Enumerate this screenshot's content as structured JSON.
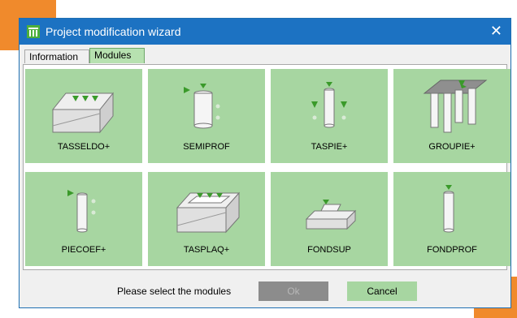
{
  "window": {
    "title": "Project modification wizard",
    "close_glyph": "✕",
    "app_icon": "table-icon"
  },
  "tabs": [
    {
      "label": "Information",
      "active": false
    },
    {
      "label": "Modules",
      "active": true
    }
  ],
  "modules": [
    {
      "label": "TASSELDO+",
      "icon": "slab-foundation-icon"
    },
    {
      "label": "SEMIPROF",
      "icon": "semi-deep-foundation-icon"
    },
    {
      "label": "TASPIE+",
      "icon": "pile-icon"
    },
    {
      "label": "GROUPIE+",
      "icon": "pile-group-icon"
    },
    {
      "label": "PIECOEF+",
      "icon": "pile-coefficient-icon"
    },
    {
      "label": "TASPLAQ+",
      "icon": "raft-foundation-icon"
    },
    {
      "label": "FONDSUP",
      "icon": "shallow-foundation-icon"
    },
    {
      "label": "FONDPROF",
      "icon": "deep-foundation-icon"
    }
  ],
  "footer": {
    "status_text": "Please select the modules",
    "ok_label": "Ok",
    "ok_enabled": false,
    "cancel_label": "Cancel"
  },
  "colors": {
    "titlebar": "#1c72c2",
    "tile": "#a7d6a1",
    "arrow": "#3a9a2a",
    "accent": "#f08a2c",
    "disabled_button": "#8c8c8c"
  }
}
